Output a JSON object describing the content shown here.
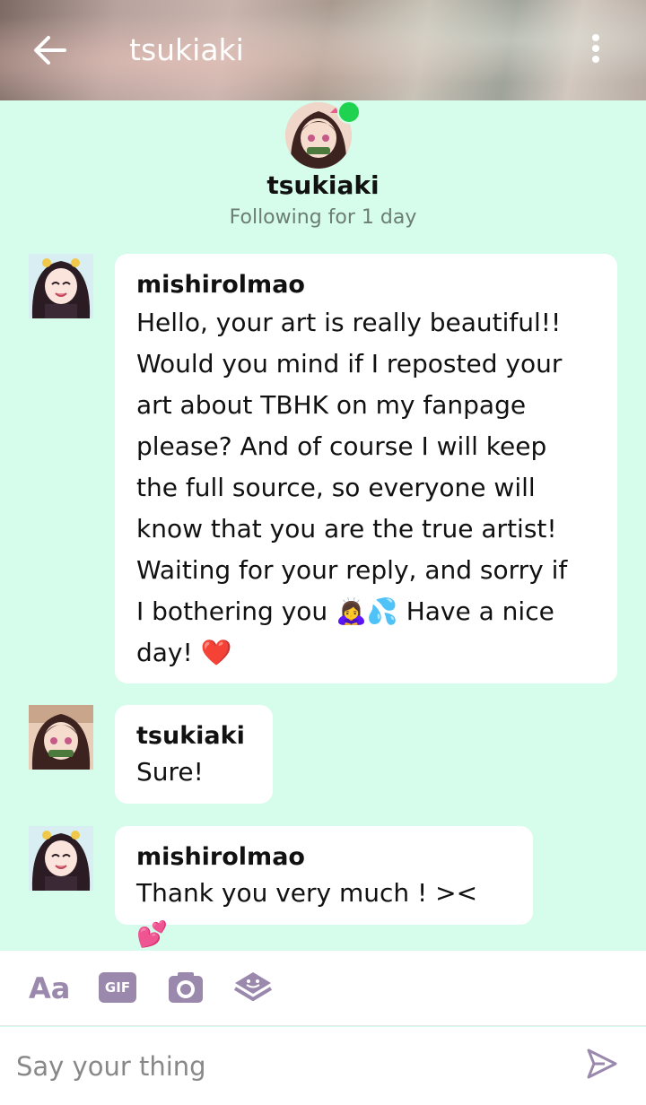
{
  "header": {
    "title": "tsukiaki",
    "back_icon": "arrow-left-icon",
    "menu_icon": "more-vertical-icon"
  },
  "profile": {
    "name": "tsukiaki",
    "subtitle": "Following for 1 day",
    "online": true,
    "online_color": "#1fd24f"
  },
  "messages": [
    {
      "sender": "mishirolmao",
      "lines": [
        "Hello, your art is really beautiful!!",
        "Would you mind if I reposted your",
        "art about TBHK on my fanpage",
        "please? And of course I will keep",
        "the full source, so everyone will",
        "know that you are the true artist!",
        "Waiting for your reply, and sorry if",
        "I bothering you 🙇‍♀️💦 Have a nice",
        "day! ❤️"
      ]
    },
    {
      "sender": "tsukiaki",
      "lines": [
        "Sure!"
      ]
    },
    {
      "sender": "mishirolmao",
      "lines": [
        "Thank you very much ! >< 💕"
      ]
    }
  ],
  "toolbar": {
    "text_style_label": "Aa",
    "gif_label": "GIF",
    "camera_icon": "camera-icon",
    "sticker_icon": "sticker-icon",
    "accent_color": "#9a88ad"
  },
  "composer": {
    "placeholder": "Say your thing",
    "value": "",
    "send_icon": "send-icon"
  },
  "colors": {
    "background": "#d6fdeb",
    "bubble": "#ffffff"
  }
}
